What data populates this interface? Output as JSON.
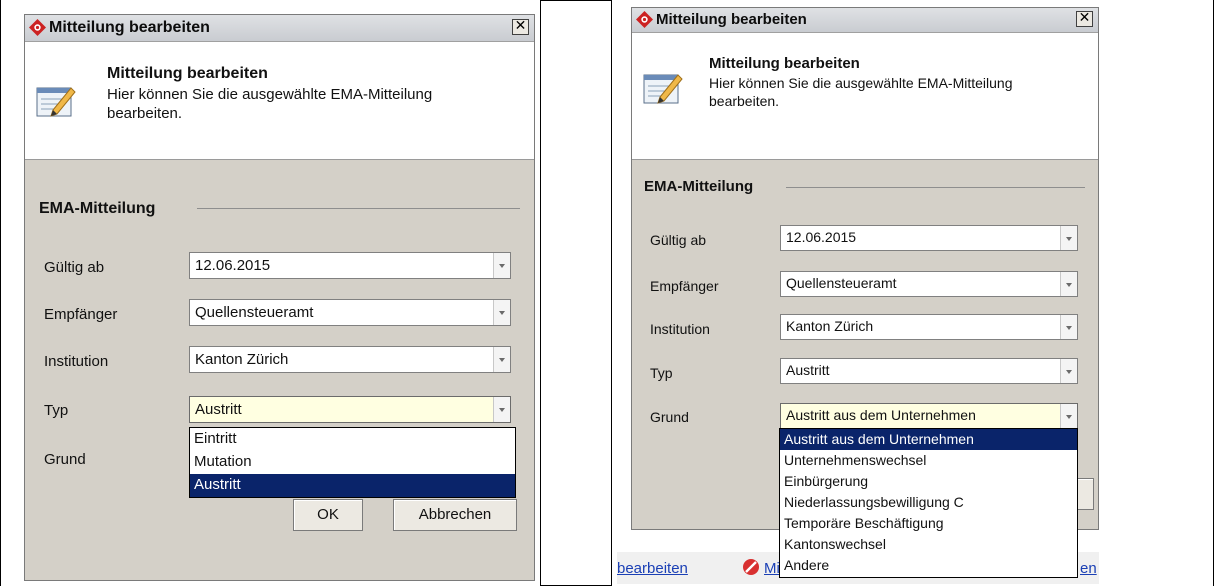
{
  "left": {
    "window_title": "Mitteilung bearbeiten",
    "close_glyph": "✕",
    "header": {
      "title": "Mitteilung bearbeiten",
      "line1": "Hier können Sie die ausgewählte EMA-Mitteilung",
      "line2": "bearbeiten."
    },
    "group_title": "EMA-Mitteilung",
    "fields": {
      "gueltig_label": "Gültig ab",
      "gueltig_value": "12.06.2015",
      "empfaenger_label": "Empfänger",
      "empfaenger_value": "Quellensteueramt",
      "institution_label": "Institution",
      "institution_value": "Kanton Zürich",
      "typ_label": "Typ",
      "typ_value": "Austritt",
      "grund_label": "Grund"
    },
    "typ_options": [
      "Eintritt",
      "Mutation",
      "Austritt"
    ],
    "buttons": {
      "ok": "OK",
      "cancel": "Abbrechen"
    }
  },
  "right": {
    "window_title": "Mitteilung bearbeiten",
    "close_glyph": "✕",
    "header": {
      "title": "Mitteilung bearbeiten",
      "line1": "Hier können Sie die ausgewählte EMA-Mitteilung",
      "line2": "bearbeiten."
    },
    "group_title": "EMA-Mitteilung",
    "fields": {
      "gueltig_label": "Gültig ab",
      "gueltig_value": "12.06.2015",
      "empfaenger_label": "Empfänger",
      "empfaenger_value": "Quellensteueramt",
      "institution_label": "Institution",
      "institution_value": "Kanton Zürich",
      "typ_label": "Typ",
      "typ_value": "Austritt",
      "grund_label": "Grund",
      "grund_value": "Austritt aus dem Unternehmen"
    },
    "grund_options": [
      "Austritt aus dem Unternehmen",
      "Unternehmenswechsel",
      "Einbürgerung",
      "Niederlassungsbewilligung C",
      "Temporäre Beschäftigung",
      "Kantonswechsel",
      "Andere"
    ],
    "background_links": {
      "left": "bearbeiten",
      "middle": "Mi",
      "right": "en"
    }
  },
  "colors": {
    "selection": "#0a246a",
    "active_field": "#ffffe1",
    "dialog_bg": "#d4d0c8"
  }
}
